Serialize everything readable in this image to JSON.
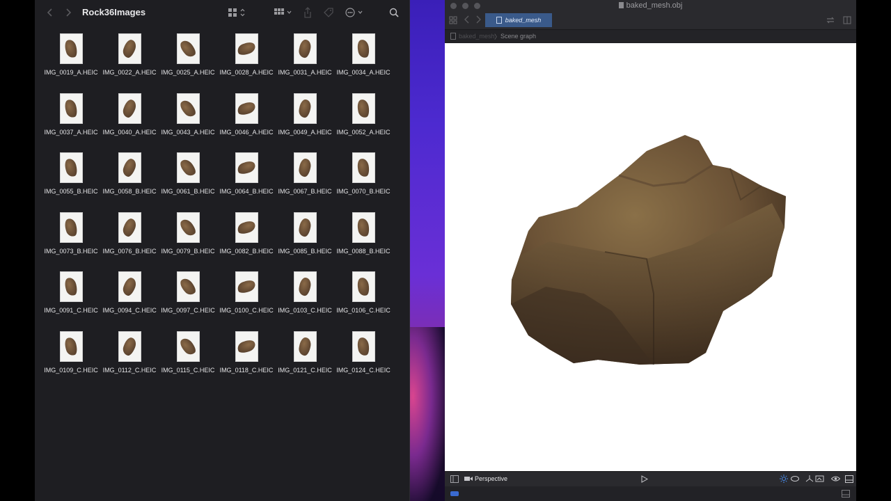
{
  "finder": {
    "title": "Rock36Images",
    "files": [
      "IMG_0019_A.HEIC",
      "IMG_0022_A.HEIC",
      "IMG_0025_A.HEIC",
      "IMG_0028_A.HEIC",
      "IMG_0031_A.HEIC",
      "IMG_0034_A.HEIC",
      "IMG_0037_A.HEIC",
      "IMG_0040_A.HEIC",
      "IMG_0043_A.HEIC",
      "IMG_0046_A.HEIC",
      "IMG_0049_A.HEIC",
      "IMG_0052_A.HEIC",
      "IMG_0055_B.HEIC",
      "IMG_0058_B.HEIC",
      "IMG_0061_B.HEIC",
      "IMG_0064_B.HEIC",
      "IMG_0067_B.HEIC",
      "IMG_0070_B.HEIC",
      "IMG_0073_B.HEIC",
      "IMG_0076_B.HEIC",
      "IMG_0079_B.HEIC",
      "IMG_0082_B.HEIC",
      "IMG_0085_B.HEIC",
      "IMG_0088_B.HEIC",
      "IMG_0091_C.HEIC",
      "IMG_0094_C.HEIC",
      "IMG_0097_C.HEIC",
      "IMG_0100_C.HEIC",
      "IMG_0103_C.HEIC",
      "IMG_0106_C.HEIC",
      "IMG_0109_C.HEIC",
      "IMG_0112_C.HEIC",
      "IMG_0115_C.HEIC",
      "IMG_0118_C.HEIC",
      "IMG_0121_C.HEIC",
      "IMG_0124_C.HEIC"
    ],
    "icons": {
      "back": "chevron-left-icon",
      "forward": "chevron-right-icon",
      "view": "grid-view-icon",
      "group": "group-icon",
      "share": "share-icon",
      "tag": "tag-icon",
      "more": "more-icon",
      "search": "search-icon"
    }
  },
  "viewer": {
    "window_title": "baked_mesh.obj",
    "tab_label": "baked_mesh",
    "breadcrumb": {
      "file": "baked_mesh",
      "section": "Scene graph"
    },
    "camera_label": "Perspective",
    "background_color": "#ffffff"
  },
  "colors": {
    "finder_bg": "#1e1e22",
    "tab_accent": "#3a5a8a",
    "rock_brown": "#6b5236"
  }
}
